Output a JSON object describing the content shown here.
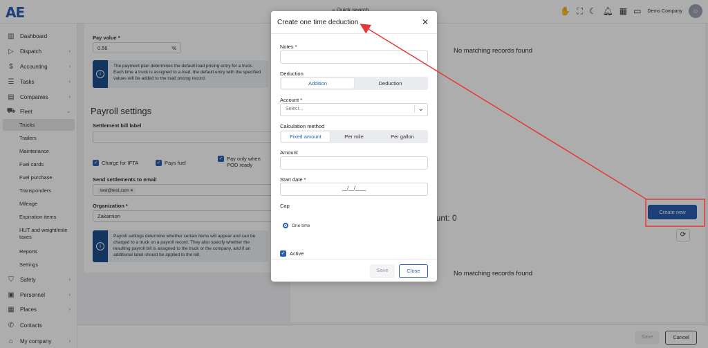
{
  "topbar": {
    "logo": "AE",
    "search_label": "Quick search",
    "company": "Demo Company",
    "icons": [
      "hand-icon",
      "expand-icon",
      "moon-icon",
      "bell-icon",
      "apps-icon",
      "wallet-icon"
    ]
  },
  "sidebar": {
    "items": [
      {
        "label": "Dashboard",
        "icon": "chart-icon",
        "chevron": false
      },
      {
        "label": "Dispatch",
        "icon": "send-icon",
        "chevron": true
      },
      {
        "label": "Accounting",
        "icon": "dollar-icon",
        "chevron": true
      },
      {
        "label": "Tasks",
        "icon": "tasks-icon",
        "chevron": true
      },
      {
        "label": "Companies",
        "icon": "building-icon",
        "chevron": true
      },
      {
        "label": "Fleet",
        "icon": "truck-icon",
        "chevron": true
      }
    ],
    "fleet_sub": [
      "Trucks",
      "Trailers",
      "Maintenance",
      "Fuel cards",
      "Fuel purchase",
      "Transponders",
      "Mileage",
      "Expiration items",
      "HUT and weight/mile taxes",
      "Reports",
      "Settings"
    ],
    "bottom_items": [
      {
        "label": "Safety",
        "icon": "shield-icon"
      },
      {
        "label": "Personnel",
        "icon": "id-card-icon"
      },
      {
        "label": "Places",
        "icon": "places-icon"
      },
      {
        "label": "Contacts",
        "icon": "phone-icon"
      },
      {
        "label": "My company",
        "icon": "home-icon"
      }
    ]
  },
  "left_panel": {
    "pay_value_label": "Pay value *",
    "pay_value": "0.56",
    "pay_value_unit": "%",
    "payment_info": "The payment plan determines the default load pricing entry for a truck. Each time a truck is assigned to a load, the default entry with the specified values will be added to the load pricing record.",
    "payroll_title": "Payroll settings",
    "settlement_label": "Settlement bill label",
    "checks": [
      "Charge for IFTA",
      "Pays fuel",
      "Pay only when POD ready"
    ],
    "send_settlements_label": "Send settlements to email",
    "email_chip": "test@test.com",
    "chip_remove": "×",
    "organization_label": "Organization *",
    "organization_value": "Zakamion",
    "payroll_info": "Payroll settings determine whether certain items will appear and can be charged to a truck on a payroll record. They also specify whether the resulting payroll bill is assigned to the truck or the company, and if an additional label should be applied to the bill."
  },
  "right_panel": {
    "no_records_top": "No matching records found",
    "count_label": "ount: 0",
    "create_new": "Create new",
    "no_records_bottom": "No matching records found"
  },
  "page_footer": {
    "save": "Save",
    "cancel": "Cancel"
  },
  "modal": {
    "title": "Create one time deduction",
    "close_glyph": "✕",
    "notes_label": "Notes *",
    "notes_value": "",
    "deduction_label": "Deduction",
    "deduction_options": [
      "Addition",
      "Deduction"
    ],
    "deduction_selected": "Addition",
    "account_label": "Account *",
    "account_placeholder": "Select...",
    "calc_label": "Calculation method",
    "calc_options": [
      "Fixed amount",
      "Per mile",
      "Per gallon"
    ],
    "calc_selected": "Fixed amount",
    "amount_label": "Amount",
    "amount_value": "",
    "start_date_label": "Start date *",
    "start_date_placeholder": "__/__/____",
    "cap_label": "Cap",
    "cap_option": "One time",
    "active_label": "Active",
    "active_checked": true,
    "save": "Save",
    "close": "Close"
  },
  "colors": {
    "accent": "#2a5fb0",
    "annotation_red": "#e53935",
    "overlay": "rgba(0,0,0,0.32)"
  }
}
